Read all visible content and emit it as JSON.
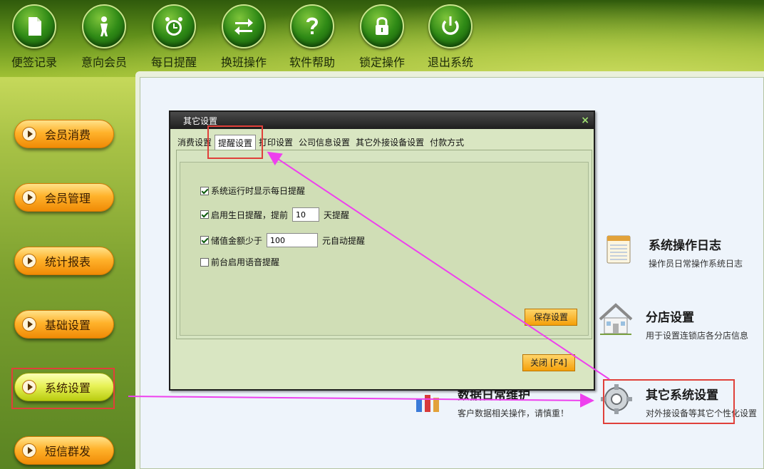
{
  "toolbar": {
    "items": [
      {
        "label": "便签记录",
        "icon": "notepad-icon"
      },
      {
        "label": "意向会员",
        "icon": "person-icon"
      },
      {
        "label": "每日提醒",
        "icon": "alarm-clock-icon"
      },
      {
        "label": "换班操作",
        "icon": "swap-arrows-icon"
      },
      {
        "label": "软件帮助",
        "icon": "help-icon"
      },
      {
        "label": "锁定操作",
        "icon": "lock-icon"
      },
      {
        "label": "退出系统",
        "icon": "power-icon"
      }
    ]
  },
  "sidebar": {
    "items": [
      {
        "label": "会员消费",
        "active": false
      },
      {
        "label": "会员管理",
        "active": false
      },
      {
        "label": "统计报表",
        "active": false
      },
      {
        "label": "基础设置",
        "active": false
      },
      {
        "label": "系统设置",
        "active": true
      },
      {
        "label": "短信群发",
        "active": false
      }
    ]
  },
  "features": {
    "log": {
      "title": "系统操作日志",
      "desc": "操作员日常操作系统日志"
    },
    "branch": {
      "title": "分店设置",
      "desc": "用于设置连锁店各分店信息"
    },
    "data": {
      "title": "数据日常维护",
      "desc": "客户数据相关操作，请慎重！"
    },
    "other": {
      "title": "其它系统设置",
      "desc": "对外接设备等其它个性化设置"
    }
  },
  "dialog": {
    "title": "其它设置",
    "close_glyph": "×",
    "tabs": [
      "消费设置",
      "提醒设置",
      "打印设置",
      "公司信息设置",
      "其它外接设备设置",
      "付款方式"
    ],
    "active_tab": 1,
    "options": {
      "opt1": {
        "label": "系统运行时显示每日提醒",
        "checked": true
      },
      "opt2": {
        "label": "启用生日提醒，提前",
        "value": "10",
        "suffix": "天提醒",
        "checked": true
      },
      "opt3": {
        "label": "储值金额少于",
        "value": "100",
        "suffix": "元自动提醒",
        "checked": true
      },
      "opt4": {
        "label": "前台启用语音提醒",
        "checked": false
      }
    },
    "save_label": "保存设置",
    "close_label": "关闭 [F4]"
  },
  "colors": {
    "annotation_red": "#e0403a",
    "annotation_magenta": "#ee40ee"
  }
}
